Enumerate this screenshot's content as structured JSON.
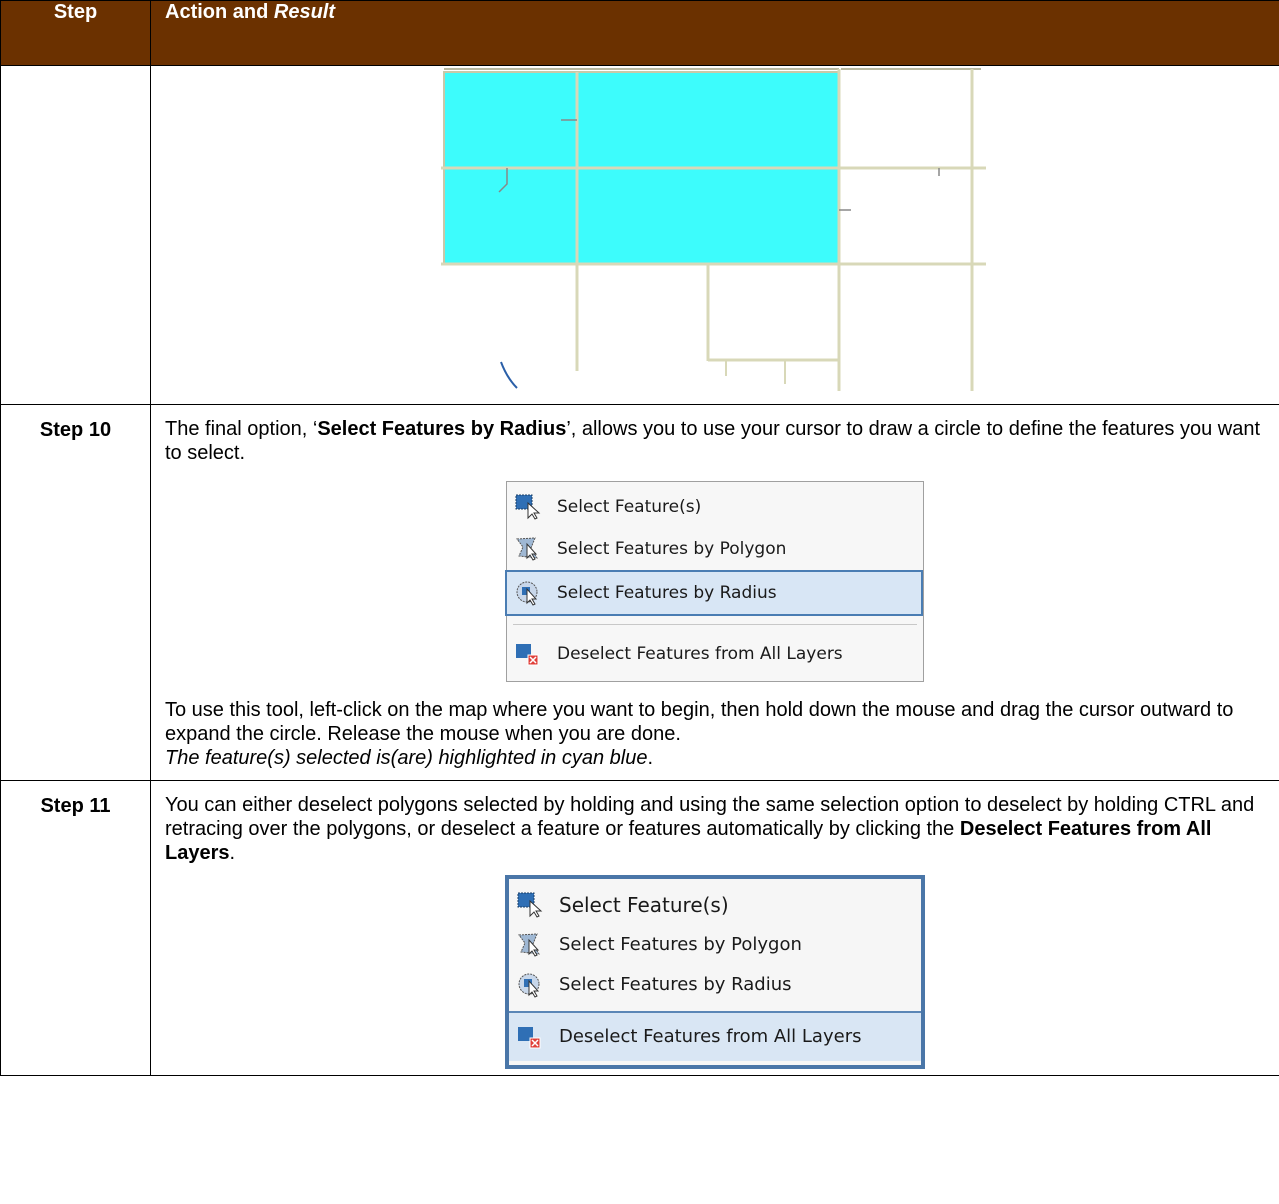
{
  "header": {
    "step": "Step",
    "action_prefix": "Action and ",
    "action_italic": "Result"
  },
  "rows": [
    {
      "step": "Step 10",
      "intro_before": "The final option, ‘",
      "intro_bold": "Select Features by Radius",
      "intro_after": "’, allows you to use your cursor to draw a circle to define the features you want to select.",
      "menu": [
        "Select Feature(s)",
        "Select Features by Polygon",
        "Select Features by Radius",
        "Deselect Features from All Layers"
      ],
      "body_text": "To use this tool, left-click on the map where you want to begin, then hold down the mouse and drag the cursor outward to expand the circle. Release the mouse when you are done.",
      "result_italic": "The feature(s) selected is(are) highlighted in cyan blue",
      "result_end": "."
    },
    {
      "step": "Step 11",
      "intro_before": "You can either deselect polygons selected by holding and using the same selection option to deselect by holding CTRL and retracing over the polygons, or deselect a feature or features automatically by clicking the ",
      "intro_bold": "Deselect Features from All Layers",
      "intro_after": ".",
      "menu": [
        "Select Feature(s)",
        "Select Features by Polygon",
        "Select Features by Radius",
        "Deselect Features from All Layers"
      ]
    }
  ],
  "colors": {
    "header_bg": "#6b3100",
    "selection": "#3dfcfc",
    "menu_highlight": "#d8e6f5",
    "menu_border": "#4a76a8"
  }
}
